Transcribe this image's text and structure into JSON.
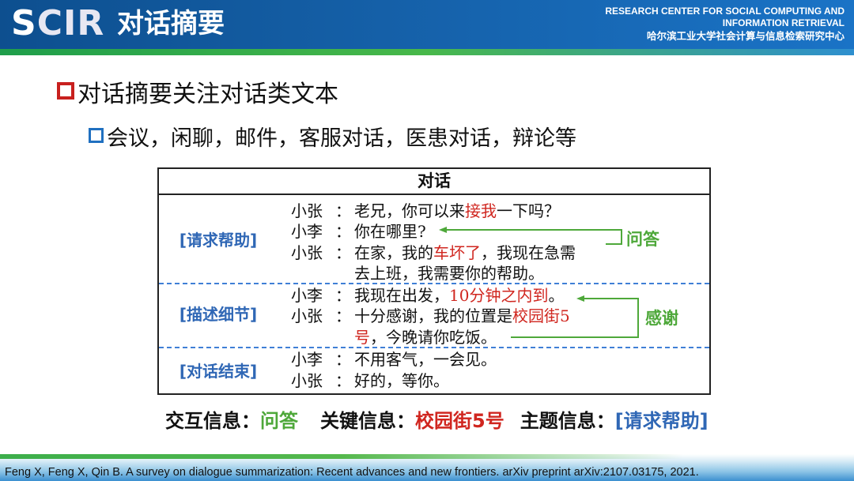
{
  "header": {
    "logo_prefix": "S",
    "logo_rest": "CIR",
    "title": "对话摘要",
    "org_en_line1": "RESEARCH CENTER FOR SOCIAL COMPUTING AND",
    "org_en_line2": "INFORMATION RETRIEVAL",
    "org_cn": "哈尔滨工业大学社会计算与信息检索研究中心"
  },
  "bullets": {
    "level1": "对话摘要关注对话类文本",
    "level2": "会议，闲聊，邮件，客服对话，医患对话，辩论等"
  },
  "dialogue": {
    "header": "对话",
    "stages": [
      "[请求帮助]",
      "[描述细节]",
      "[对话结束]"
    ],
    "colon": "：",
    "turns": [
      {
        "speaker": "小张",
        "pre": "老兄，你可以来",
        "hl": "接我",
        "post": "一下吗？"
      },
      {
        "speaker": "小李",
        "pre": "你在哪里?",
        "hl": "",
        "post": ""
      },
      {
        "speaker": "小张",
        "pre": "在家，我的",
        "hl": "车坏了",
        "post": "，我现在急需"
      },
      {
        "speaker": "",
        "pre": "去上班，我需要你的帮助。",
        "hl": "",
        "post": ""
      },
      {
        "speaker": "小李",
        "pre": "我现在出发，",
        "hl": "10分钟之内到",
        "post": "。"
      },
      {
        "speaker": "小张",
        "pre": "十分感谢，我的位置是",
        "hl": "校园街5",
        "post": ""
      },
      {
        "speaker": "",
        "pre": "",
        "hl": "号",
        "post": "，今晚请你吃饭。"
      },
      {
        "speaker": "小李",
        "pre": "不用客气，一会见。",
        "hl": "",
        "post": ""
      },
      {
        "speaker": "小张",
        "pre": "好的，等你。",
        "hl": "",
        "post": ""
      }
    ],
    "annotations": [
      "问答",
      "感谢"
    ]
  },
  "summary": {
    "interaction_label": "交互信息：",
    "interaction_value": "问答",
    "key_label": "关键信息：",
    "key_value": "校园街5号",
    "topic_label": "主题信息：",
    "topic_value": "[请求帮助]"
  },
  "citation": "Feng X, Feng X, Qin B. A survey on dialogue summarization: Recent advances and new frontiers. arXiv preprint arXiv:2107.03175, 2021.",
  "colors": {
    "header_blue": "#1560a8",
    "accent_green": "#4ea83a",
    "accent_red": "#d0261f",
    "accent_blue": "#2f67b5"
  }
}
